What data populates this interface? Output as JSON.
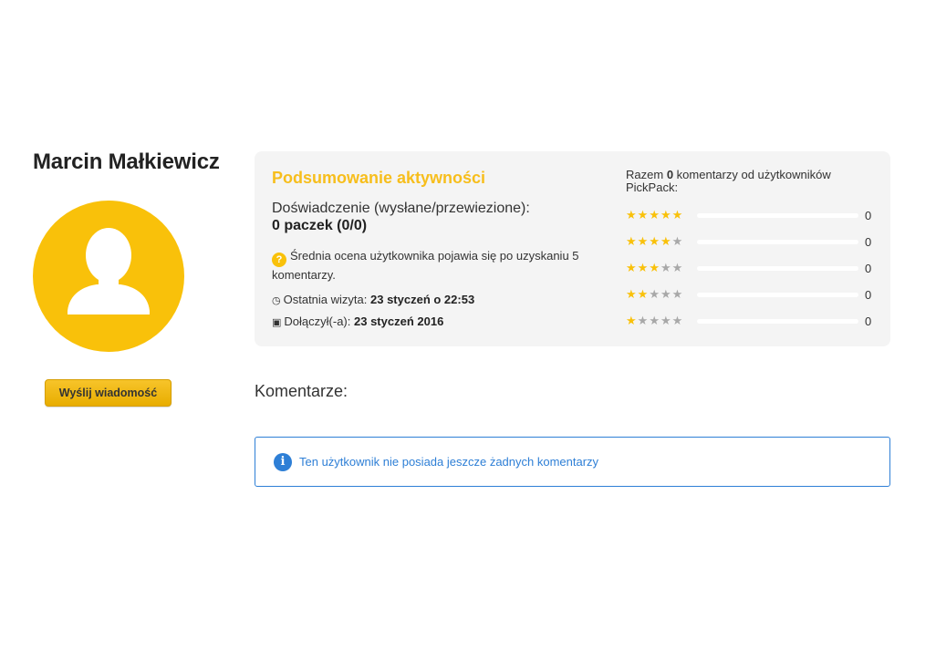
{
  "profile": {
    "name": "Marcin Małkiewicz",
    "avatar_icon": "user-silhouette-icon",
    "avatar_color": "#f9c10a",
    "send_message_label": "Wyślij wiadomość"
  },
  "summary": {
    "title": "Podsumowanie aktywności",
    "experience_label": "Doświadczenie (wysłane/przewiezione):",
    "experience_value": "0 paczek (0/0)",
    "rating_info_badge": "?",
    "rating_info": "Średnia ocena użytkownika pojawia się po uzyskaniu 5 komentarzy.",
    "last_visit_label": "Ostatnia wizyta:",
    "last_visit_value": "23 styczeń o 22:53",
    "joined_label": "Dołączył(-a):",
    "joined_value": "23 styczeń 2016",
    "total_prefix": "Razem",
    "total_count": "0",
    "total_suffix": "komentarzy od użytkowników PickPack:",
    "ratings": [
      {
        "stars": 5,
        "count": "0"
      },
      {
        "stars": 4,
        "count": "0"
      },
      {
        "stars": 3,
        "count": "0"
      },
      {
        "stars": 2,
        "count": "0"
      },
      {
        "stars": 1,
        "count": "0"
      }
    ]
  },
  "comments": {
    "heading": "Komentarze:",
    "notice_icon": "info-icon",
    "notice_text": "Ten użytkownik nie posiada jeszcze żadnych komentarzy"
  },
  "colors": {
    "accent": "#f9c10a",
    "title_yellow": "#f7be1c",
    "info_blue": "#2e7fd6",
    "panel_bg": "#f4f4f4"
  }
}
